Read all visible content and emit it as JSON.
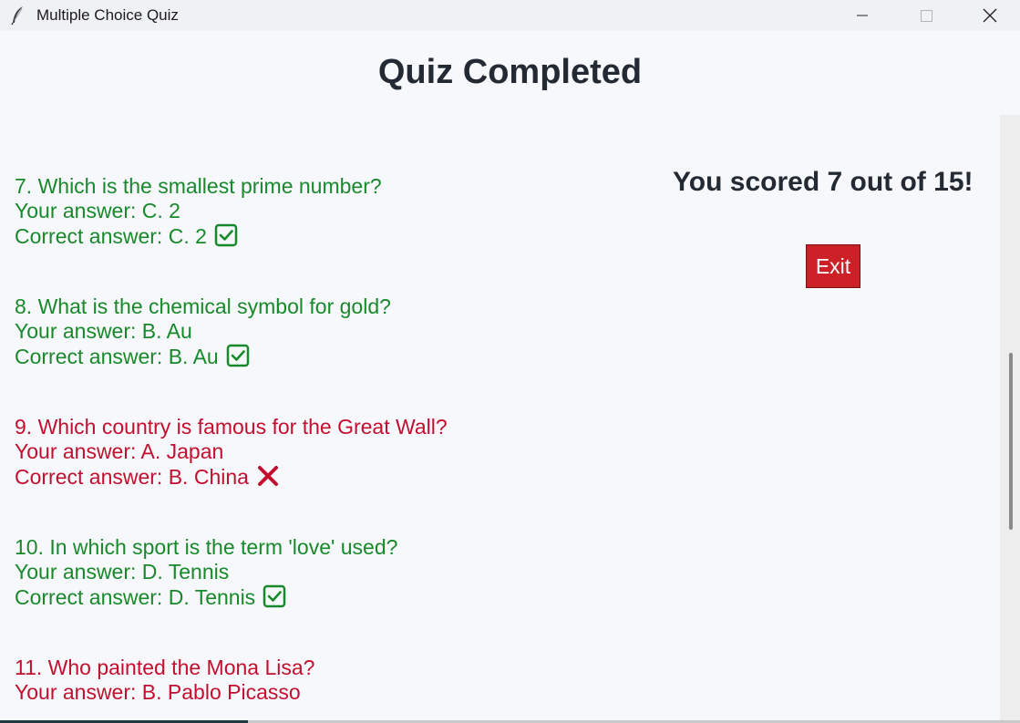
{
  "window": {
    "title": "Multiple Choice Quiz",
    "app_icon": "feather-icon",
    "controls": [
      "minimize-icon",
      "maximize-icon",
      "close-icon"
    ]
  },
  "heading": "Quiz Completed",
  "score_text": "You scored 7 out of 15!",
  "exit_label": "Exit",
  "colors": {
    "correct": "#18892b",
    "incorrect": "#c30f2e",
    "exit_button": "#cc2227"
  },
  "questions": [
    {
      "question": "7. Which is the smallest prime number?",
      "your_answer": "Your answer: C. 2",
      "correct_answer": "Correct answer: C. 2",
      "status": "correct",
      "icon": "check-box-icon"
    },
    {
      "question": "8. What is the chemical symbol for gold?",
      "your_answer": "Your answer: B. Au",
      "correct_answer": "Correct answer: B. Au",
      "status": "correct",
      "icon": "check-box-icon"
    },
    {
      "question": "9. Which country is famous for the Great Wall?",
      "your_answer": "Your answer: A. Japan",
      "correct_answer": "Correct answer: B. China",
      "status": "incorrect",
      "icon": "cross-icon"
    },
    {
      "question": "10. In which sport is the term 'love' used?",
      "your_answer": "Your answer: D. Tennis",
      "correct_answer": "Correct answer: D. Tennis",
      "status": "correct",
      "icon": "check-box-icon"
    },
    {
      "question": "11. Who painted the Mona Lisa?",
      "your_answer": "Your answer: B. Pablo Picasso",
      "correct_answer": "",
      "status": "incorrect",
      "icon": ""
    }
  ]
}
